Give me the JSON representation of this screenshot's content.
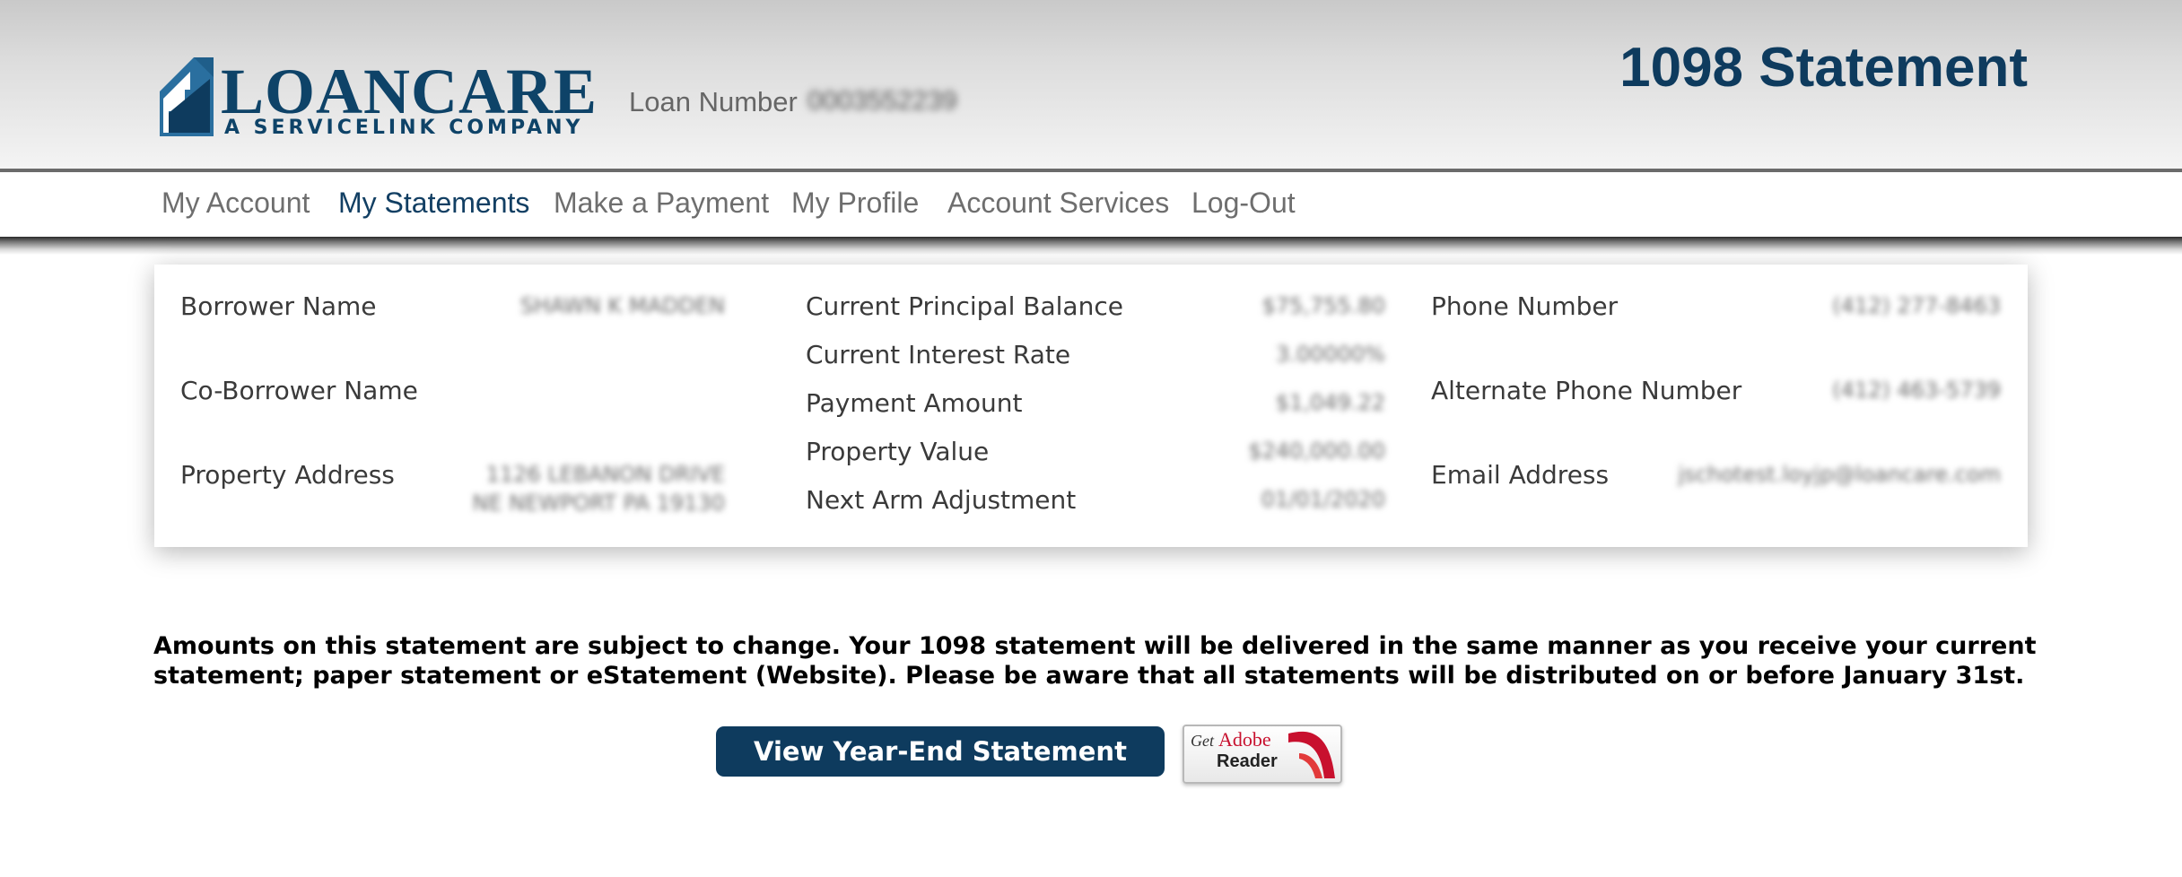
{
  "header": {
    "logo_text": "LOANCARE",
    "logo_subtext": "A SERVICELINK COMPANY",
    "loan_number_label": "Loan Number",
    "loan_number_value": "0003552239",
    "page_title": "1098 Statement"
  },
  "nav": {
    "items": [
      {
        "label": "My Account"
      },
      {
        "label": "My Statements",
        "active": true
      },
      {
        "label": "Make a Payment"
      },
      {
        "label": "My Profile"
      },
      {
        "label": "Account Services"
      },
      {
        "label": "Log-Out"
      }
    ]
  },
  "account_info": {
    "borrower": {
      "label": "Borrower Name",
      "value": "SHAWN K MADDEN"
    },
    "co_borrower": {
      "label": "Co-Borrower Name",
      "value": ""
    },
    "property_address": {
      "label": "Property Address",
      "value_line1": "1126 LEBANON DRIVE",
      "value_line2": "NE NEWPORT PA 19130"
    },
    "principal_balance": {
      "label": "Current Principal Balance",
      "value": "$75,755.80"
    },
    "interest_rate": {
      "label": "Current Interest Rate",
      "value": "3.00000%"
    },
    "payment_amount": {
      "label": "Payment Amount",
      "value": "$1,049.22"
    },
    "property_value": {
      "label": "Property Value",
      "value": "$240,000.00"
    },
    "arm_adjustment": {
      "label": "Next Arm Adjustment",
      "value": "01/01/2020"
    },
    "phone": {
      "label": "Phone Number",
      "value": "(412) 277-8463"
    },
    "alt_phone": {
      "label": "Alternate Phone Number",
      "value": "(412) 463-5739"
    },
    "email": {
      "label": "Email Address",
      "value": "jschotest.loyjp@loancare.com"
    }
  },
  "notice": "Amounts on this statement are subject to change. Your 1098 statement will be delivered in the same manner as you receive your current statement; paper statement or eStatement (Website). Please be aware that all statements will be distributed on or before January 31st.",
  "actions": {
    "view_statement_label": "View Year-End Statement",
    "adobe_get": "Get",
    "adobe_brand": "Adobe",
    "adobe_reader": "Reader"
  },
  "colors": {
    "brand_navy": "#0e3b5e",
    "nav_active": "#123f63",
    "nav_inactive": "#6e6e6e"
  }
}
